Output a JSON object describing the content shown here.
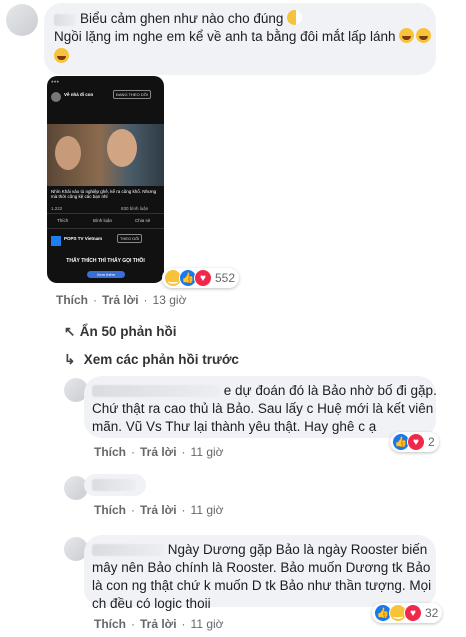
{
  "comment1": {
    "line1": "Biểu cảm ghen như nào cho đúng",
    "line2": "Ngồi lặng im nghe em kể về anh ta bằng đôi mắt lấp lánh",
    "reaction_count": "552",
    "actions": {
      "like": "Thích",
      "reply": "Trả lời",
      "time": "13 giờ"
    },
    "phone": {
      "page_name": "Về nhà đi con",
      "following": "ĐANG THEO DÕI",
      "caption": "Nhìn Khải vào tù nghiệp ghê, kể ra cũng khổ. Nhưng mà thời cũng kệ các bạn nhỉ",
      "stat": "1.222",
      "comments_stat": "830 bình luận",
      "share_like": "Thích",
      "share_comment": "Bình luận",
      "share_share": "Chia sẻ",
      "second_page": "POPS TV Vietnam",
      "second_follow": "THEO DÕI",
      "banner": "THẤY THÍCH THÌ THẤY GỌI THÔI",
      "watch": "Xem thêm"
    }
  },
  "thread": {
    "hide_replies": "Ẩn 50 phản hồi",
    "prev_replies": "Xem các phản hồi trước"
  },
  "reply1": {
    "text_line1": "e dự đoán đó là Bảo nhờ bố đi gặp.",
    "text_line2": "Chứ thật ra cao thủ là Bảo. Sau lấy c Huệ mới là kết viên",
    "text_line3": "mãn. Vũ Vs Thư lại thành yêu thật. Hay ghê c ạ",
    "reaction_count": "2",
    "actions": {
      "like": "Thích",
      "reply": "Trả lời",
      "time": "11 giờ"
    }
  },
  "reply2": {
    "actions": {
      "like": "Thích",
      "reply": "Trả lời",
      "time": "11 giờ"
    }
  },
  "reply3": {
    "text_line1": "Ngày Dương gặp Bảo là ngày Rooster biến",
    "text_line2": "mây nên Bảo chính là Rooster. Bảo muốn Dương tk Bảo",
    "text_line3": "là con ng thật chứ k muốn D tk Bảo như thần tượng. Mọi",
    "text_line4": "ch đều có logic thoii",
    "reaction_count": "32",
    "actions": {
      "like": "Thích",
      "reply": "Trả lời",
      "time": "11 giờ"
    }
  },
  "colors": {
    "bubble": "#f0f2f5",
    "meta": "#65676b",
    "like_blue": "#1877f2",
    "love_red": "#f02849",
    "haha_yellow": "#f7c33b"
  }
}
